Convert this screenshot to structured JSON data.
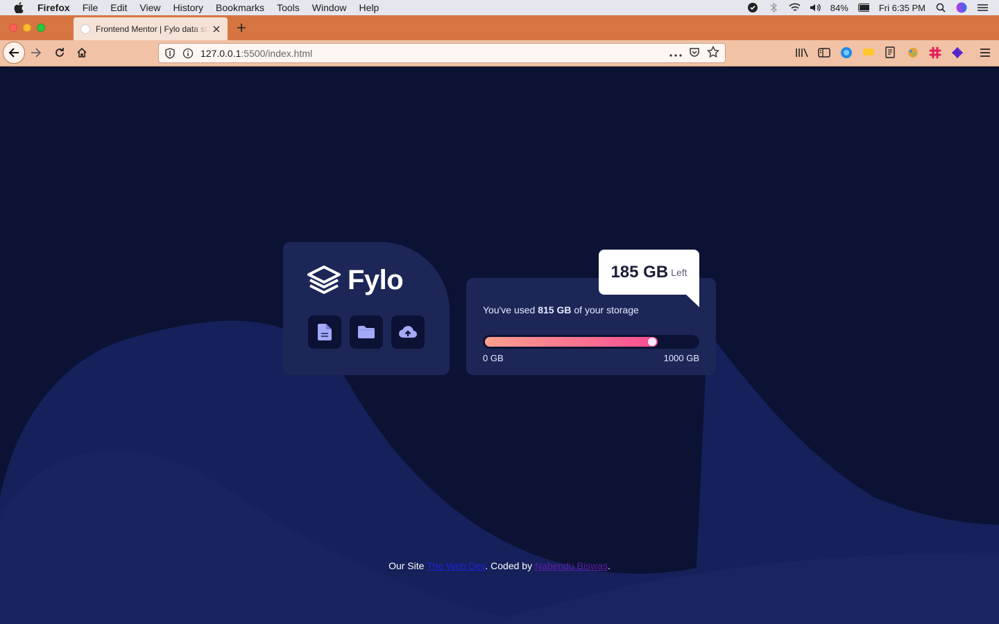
{
  "menubar": {
    "app_name": "Firefox",
    "items": [
      "File",
      "Edit",
      "View",
      "History",
      "Bookmarks",
      "Tools",
      "Window",
      "Help"
    ],
    "battery": "84%",
    "clock": "Fri 6:35 PM"
  },
  "browser": {
    "tab_title": "Frontend Mentor | Fylo data storage component",
    "url_host": "127.0.0.1",
    "url_path": ":5500/index.html"
  },
  "page": {
    "logo_text": "Fylo",
    "icon_buttons": [
      "document-icon",
      "folder-icon",
      "upload-icon"
    ],
    "usage_prefix": "You've used ",
    "usage_amount": "815 GB",
    "usage_suffix": " of your storage",
    "progress_fraction": 0.815,
    "range_min": "0 GB",
    "range_max": "1000 GB",
    "badge_value": "185 GB",
    "badge_unit": "Left",
    "footer_prefix": "Our Site ",
    "footer_link1": "The Web Dev",
    "footer_mid": ". Coded by ",
    "footer_link2": "Nabendu Biswas",
    "footer_suffix": "."
  },
  "colors": {
    "page_bg": "#0c1233",
    "card_bg": "#1c2757",
    "gradient_start": "#fc9f8e",
    "gradient_end": "#f54e93",
    "tab_strip": "#d67542"
  }
}
